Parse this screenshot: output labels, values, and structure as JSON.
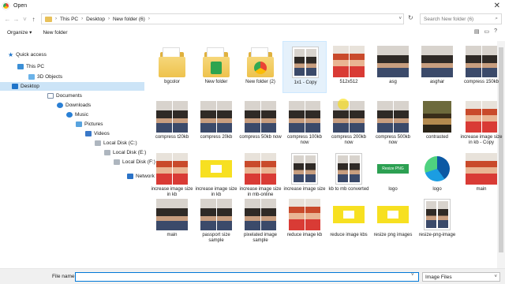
{
  "window": {
    "title": "Open",
    "close_glyph": "✕"
  },
  "address": {
    "crumbs": [
      "This PC",
      "Desktop",
      "New folder (6)"
    ],
    "separator": "›",
    "search_placeholder": "Search New folder (6)"
  },
  "toolbar": {
    "organize_label": "Organize ▾",
    "new_folder_label": "New folder"
  },
  "sidebar": {
    "items": [
      {
        "label": "Quick access",
        "icon": "star-icon"
      },
      {
        "label": "This PC",
        "icon": "computer-icon"
      },
      {
        "label": "3D Objects",
        "icon": "cube-icon"
      },
      {
        "label": "Desktop",
        "icon": "desktop-icon"
      },
      {
        "label": "Documents",
        "icon": "document-icon"
      },
      {
        "label": "Downloads",
        "icon": "download-icon"
      },
      {
        "label": "Music",
        "icon": "music-icon"
      },
      {
        "label": "Pictures",
        "icon": "pictures-icon"
      },
      {
        "label": "Videos",
        "icon": "video-icon"
      },
      {
        "label": "Local Disk (C:)",
        "icon": "disk-icon"
      },
      {
        "label": "Local Disk (E:)",
        "icon": "disk-icon"
      },
      {
        "label": "Local Disk (F:)",
        "icon": "disk-icon"
      },
      {
        "label": "Network",
        "icon": "network-icon"
      }
    ]
  },
  "files": [
    {
      "name": "bgcolor",
      "kind": "folder-plain"
    },
    {
      "name": "New folder",
      "kind": "folder-green"
    },
    {
      "name": "New folder (2)",
      "kind": "folder-chrome"
    },
    {
      "name": "1x1 - Copy",
      "kind": "doc-man"
    },
    {
      "name": "512x512",
      "kind": "photo-girls"
    },
    {
      "name": "asg",
      "kind": "photo-man"
    },
    {
      "name": "asghar",
      "kind": "photo-man"
    },
    {
      "name": "compress 150kb",
      "kind": "photo-men"
    },
    {
      "name": "compress t20kb",
      "kind": "photo-men"
    },
    {
      "name": "compress 20kb",
      "kind": "photo-men"
    },
    {
      "name": "compress 50kb now",
      "kind": "photo-men"
    },
    {
      "name": "compress 100kb now",
      "kind": "photo-men"
    },
    {
      "name": "compress 200kb now",
      "kind": "photo-men"
    },
    {
      "name": "compress 500kb now",
      "kind": "photo-men"
    },
    {
      "name": "contrasted",
      "kind": "mona"
    },
    {
      "name": "increase image size in kb - Copy",
      "kind": "photo-girls"
    },
    {
      "name": "increase image size in kb",
      "kind": "photo-girls"
    },
    {
      "name": "increase image size in kb",
      "kind": "yellow"
    },
    {
      "name": "increase image size in mb-online",
      "kind": "photo-girls"
    },
    {
      "name": "increase image size",
      "kind": "doc-man"
    },
    {
      "name": "kb to mb converted",
      "kind": "doc-man"
    },
    {
      "name": "logo",
      "kind": "green-badge"
    },
    {
      "name": "logo",
      "kind": "edge"
    },
    {
      "name": "main",
      "kind": "photo-girl"
    },
    {
      "name": "main",
      "kind": "photo-man"
    },
    {
      "name": "passport size sample",
      "kind": "photo-men"
    },
    {
      "name": "pixelated image sample",
      "kind": "photo-men"
    },
    {
      "name": "reduce image kb",
      "kind": "photo-girls"
    },
    {
      "name": "reduce image kbs",
      "kind": "yellow"
    },
    {
      "name": "resize png images",
      "kind": "yellow"
    },
    {
      "name": "resize-png-image",
      "kind": "doc-man"
    }
  ],
  "green_badge_text": "Resize PNG",
  "footer": {
    "filename_label": "File name:",
    "filename_value": "",
    "filetype": "Image Files"
  }
}
